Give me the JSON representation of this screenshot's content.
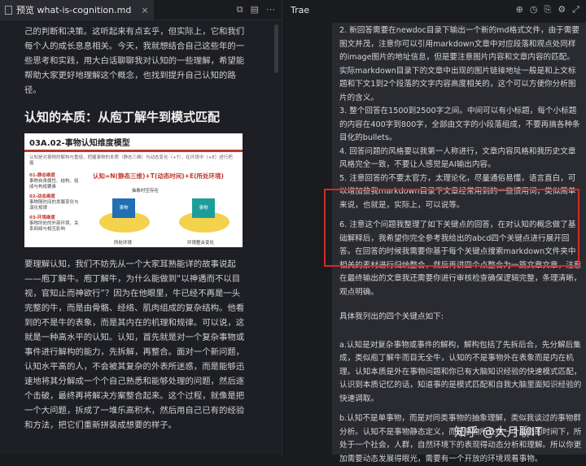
{
  "left": {
    "tab": {
      "label": "预览 what-is-cognition.md",
      "close": "×"
    },
    "actions": [
      "⧉",
      "▤",
      "⋯"
    ],
    "intro": "己的判断和决策。这听起来有点玄乎，但实际上，它和我们每个人的成长息息相关。今天，我就想结合自己这些年的一些思考和实践，用大白话聊聊我对认知的一些理解，希望能帮助大家更好地理解这个概念，也找到提升自己认知的路径。",
    "heading": "认知的本质：从庖丁解牛到模式匹配",
    "figure": {
      "title": "03A.02-事物认知维度模型",
      "subtitle": "认知是对事物的解构与重组，把握事物的本质（静态三维）与动态变化（+T），在环境中（+E）进行把握",
      "list": [
        {
          "head": "01-静态维度",
          "body": "事物自身属性、结构、组成与构成要素"
        },
        {
          "head": "02-动态维度",
          "body": "事物随时间的发展变化与演化规律"
        },
        {
          "head": "03-环境维度",
          "body": "事物所处的外部环境、关系网络与相互影响"
        }
      ],
      "formula": "认知=N(静态三维)+T(动态时间)+E(所处环境)",
      "labels": {
        "center": "抽象时空存在",
        "left_cube": "事物",
        "right_cube": "事物",
        "left_env": "所处环境",
        "right_env": "环境整合变化"
      }
    },
    "body": "要理解认知，我们不妨先从一个大家耳熟能详的故事说起——庖丁解牛。庖丁解牛，为什么能做到“以神遇而不以目视，官知止而神欲行”？因为在他眼里，牛已经不再是一头完整的牛，而是由骨骼、经络、肌肉组成的复杂结构。他看到的不是牛的表象，而是其内在的机理和规律。可以说，这就是一种高水平的认知。认知，首先就是对一个复杂事物或事件进行解构的能力，先拆解，再整合。面对一个新问题，认知水平高的人，不会被其复杂的外表所迷惑，而是能够迅速地将其分解成一个个自己熟悉和能够处理的问题，然后逐个击破，最终再将解决方案整合起来。这个过程，就像是把一个大问题，拆成了一堆乐高积木，然后用自己已有的经验和方法，把它们重新拼装成想要的样子。"
  },
  "right": {
    "title": "Trae",
    "icons": [
      "⊕",
      "◷",
      "⎘",
      "⚙",
      "⤢"
    ],
    "items": [
      "2. 新回答需要在newdoc目录下输出一个新的md格式文件，由于需要图文并茂，注意你可以引用markdown文章中对应段落和观点处同样的image图片的地址信息，但是要注意图片内容和文章内容的匹配。实际markdown目录下的文章中出现的图片链接地址一般是和上文标题和下文1到2个段落的文字内容高度相关的，这个可以方便你分析图片的含义。",
      "3. 整个回答在1500到2500字之间。中间可以有小标题，每个小标题的内容在400字到800字，全部由文字的小段落组成，不要再搞各种条目化的bullets。",
      "4. 回答问题的风格要以我第一人称进行，文章内容风格和我历史文章风格完全一致，不要让人感觉是AI输出内容。",
      "5. 注意回答的不要太官方，太理论化，尽量通俗易懂，语言直白，可以增加些我markdown目录下文章经常用到的一些惯用词，类似简单来说，也就是，实际上，可以说等。",
      "6. 注意这个问题我整理了如下关键点的回答，在对认知的概念做了基础解释后，我希望你完全参考我给出的abcd四个关键点进行展开回答。在回答的时候我需要你基于每个关键点搜索markdown文件夹中相关的素材进行归纳整合，然后再讲四个点整合为一篇文章文章，注意在最终输出的文章我还需要你进行审核检查确保逻辑完整，条理清晰，观点明确。",
      "具体我列出的四个关键点如下:",
      "a.认知是对复杂事物或事件的解构，解构包括了先拆后合，先分解后集成，类似庖丁解牛而目无全牛，认知的不是事物外在表象而是内在机理。认知本质是外在事物问题和你已有大脑知识经验的快速模式匹配，认识到本质记忆的话，知道事的是模式匹配和自我大脑里面知识经验的快速调取。",
      "b.认知不是单事物，而是对同类事物的抽象理解，类似我谈过的事物群分析。认知不是事物静态定义，而是事物所处在一个动态的时间下，所处于一个社会，人群，自然环境下的表现得动态分析和理解。所以你更加需要动态发展得眼光，需要有一个开放的环境观看事物。"
    ],
    "watermark": "知乎 @大月聊IT"
  }
}
